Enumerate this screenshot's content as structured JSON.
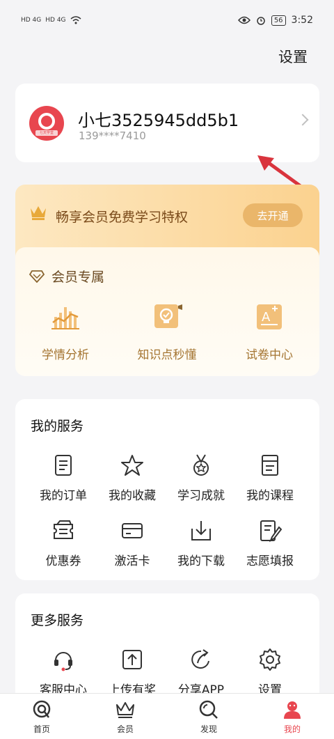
{
  "status_bar": {
    "sim1": "HD 4G",
    "sim2": "HD 4G",
    "battery": "56",
    "time": "3:52"
  },
  "header": {
    "settings_label": "设置"
  },
  "profile": {
    "name": "小七3525945dd5b1",
    "phone": "139****7410",
    "avatar_tag": "七天学堂"
  },
  "vip_banner": {
    "text": "畅享会员免费学习特权",
    "button_label": "去开通"
  },
  "member_exclusive": {
    "title": "会员专属",
    "items": [
      {
        "label": "学情分析",
        "icon": "chart-icon"
      },
      {
        "label": "知识点秒懂",
        "icon": "lightbulb-icon"
      },
      {
        "label": "试卷中心",
        "icon": "exam-icon"
      }
    ]
  },
  "my_services": {
    "title": "我的服务",
    "items": [
      {
        "label": "我的订单",
        "icon": "order-icon"
      },
      {
        "label": "我的收藏",
        "icon": "star-icon"
      },
      {
        "label": "学习成就",
        "icon": "medal-icon"
      },
      {
        "label": "我的课程",
        "icon": "course-icon"
      },
      {
        "label": "优惠券",
        "icon": "coupon-icon"
      },
      {
        "label": "激活卡",
        "icon": "card-icon"
      },
      {
        "label": "我的下载",
        "icon": "download-icon"
      },
      {
        "label": "志愿填报",
        "icon": "form-edit-icon"
      }
    ]
  },
  "more_services": {
    "title": "更多服务",
    "items": [
      {
        "label": "客服中心",
        "icon": "headset-icon"
      },
      {
        "label": "上传有奖",
        "icon": "upload-icon"
      },
      {
        "label": "分享APP",
        "icon": "share-icon"
      },
      {
        "label": "设置",
        "icon": "gear-icon"
      }
    ]
  },
  "tabbar": {
    "tabs": [
      {
        "label": "首页",
        "icon": "home-icon",
        "active": false
      },
      {
        "label": "会员",
        "icon": "crown-icon",
        "active": false
      },
      {
        "label": "发现",
        "icon": "discover-icon",
        "active": false
      },
      {
        "label": "我的",
        "icon": "profile-icon",
        "active": true
      }
    ]
  },
  "colors": {
    "accent": "#e8464f",
    "gold_text": "#a47532",
    "vip_button": "#eab66a",
    "annotation_arrow": "#d9343d"
  }
}
